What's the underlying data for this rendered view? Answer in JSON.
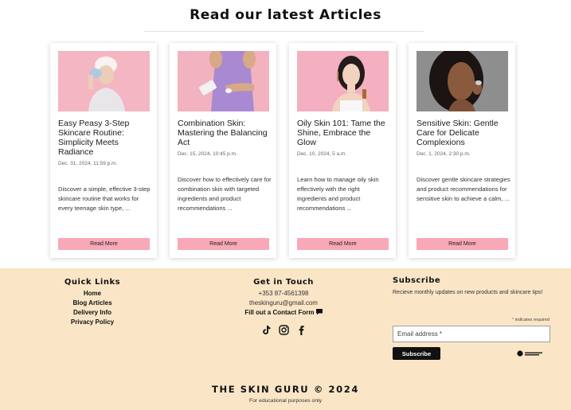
{
  "articles": {
    "title": "Read our latest Articles",
    "read_more_label": "Read More",
    "cards": [
      {
        "title": "Easy Peasy 3-Step Skincare Routine: Simplicity Meets Radiance",
        "date": "Dec. 31, 2024, 11:59 p.m.",
        "excerpt": "Discover a simple, effective 3-step skincare routine that works for every teenage skin type, ..."
      },
      {
        "title": "Combination Skin: Mastering the Balancing Act",
        "date": "Dec. 15, 2024, 10:45 p.m.",
        "excerpt": "Discover how to effectively care for combination skin with targeted ingredients and product recommendations ..."
      },
      {
        "title": "Oily Skin 101: Tame the Shine, Embrace the Glow",
        "date": "Dec. 10, 2024, 5 a.m.",
        "excerpt": "Learn how to manage oily skin effectively with the right ingredients and product recommendations ..."
      },
      {
        "title": "Sensitive Skin: Gentle Care for Delicate Complexions",
        "date": "Dec. 1, 2024, 2:30 p.m.",
        "excerpt": "Discover gentle skincare strategies and product recommendations for sensitive skin to achieve a calm, ..."
      }
    ]
  },
  "footer": {
    "quick_links": {
      "title": "Quick Links",
      "items": [
        "Home",
        "Blog Articles",
        "Delivery Info",
        "Privacy Policy"
      ]
    },
    "contact": {
      "title": "Get in Touch",
      "phone": "+353 87-4561398",
      "email": "theskinguru@gmail.com",
      "form_link": "Fill out a Contact Form",
      "socials": [
        "tiktok-icon",
        "instagram-icon",
        "facebook-icon"
      ]
    },
    "subscribe": {
      "title": "Subscribe",
      "text": "Recieve monthly updates on new products and skincare tips!",
      "required_note": "indicates required",
      "email_placeholder": "Email address *",
      "button_label": "Subscribe"
    },
    "brand": "THE SKIN GURU © 2024",
    "note": "For educational purposes only"
  },
  "colors": {
    "accent_pink": "#f9a8b8",
    "footer_bg": "#fae6c6",
    "thumb_pink": "#f4b8c4"
  }
}
